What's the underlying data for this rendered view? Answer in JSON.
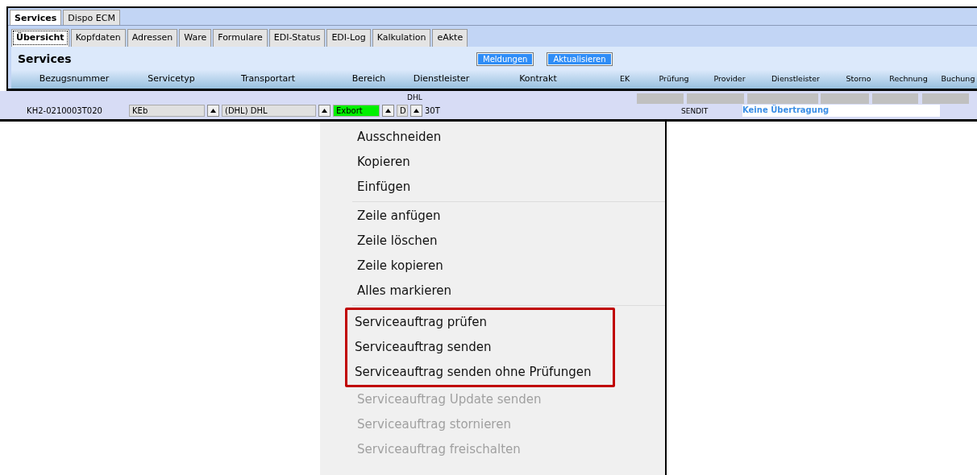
{
  "outer_tabs": [
    {
      "label": "Services",
      "selected": true
    },
    {
      "label": "Dispo ECM",
      "selected": false
    }
  ],
  "inner_tabs": [
    {
      "label": "Übersicht",
      "selected": true
    },
    {
      "label": "Kopfdaten",
      "selected": false
    },
    {
      "label": "Adressen",
      "selected": false
    },
    {
      "label": "Ware",
      "selected": false
    },
    {
      "label": "Formulare",
      "selected": false
    },
    {
      "label": "EDI-Status",
      "selected": false
    },
    {
      "label": "EDI-Log",
      "selected": false
    },
    {
      "label": "Kalkulation",
      "selected": false
    },
    {
      "label": "eAkte",
      "selected": false
    }
  ],
  "panel": {
    "title": "Services",
    "buttons": [
      "Meldungen",
      "Aktualisieren"
    ]
  },
  "columns": [
    "Bezugsnummer",
    "Servicetyp",
    "Transportart",
    "Bereich",
    "Dienstleister",
    "Kontrakt",
    "EK",
    "Prüfung",
    "Provider",
    "Dienstleister",
    "Storno",
    "Rechnung",
    "Buchung"
  ],
  "row": {
    "reference": "KH2-0210003T020",
    "servicetyp": "KEb",
    "transportart": "(DHL) DHL",
    "bereich": "Exbort",
    "dienstleister_label": "DHL",
    "dienstleister": "D",
    "kontrakt": "30T",
    "provider": "SENDIT",
    "status": "Keine Übertragung"
  },
  "context_menu": {
    "sections": [
      {
        "items": [
          {
            "label": "Ausschneiden",
            "disabled": false,
            "highlighted": false
          },
          {
            "label": "Kopieren",
            "disabled": false,
            "highlighted": false
          },
          {
            "label": "Einfügen",
            "disabled": false,
            "highlighted": false
          }
        ]
      },
      {
        "items": [
          {
            "label": "Zeile anfügen",
            "disabled": false,
            "highlighted": false
          },
          {
            "label": "Zeile löschen",
            "disabled": false,
            "highlighted": false
          },
          {
            "label": "Zeile kopieren",
            "disabled": false,
            "highlighted": false
          },
          {
            "label": "Alles markieren",
            "disabled": false,
            "highlighted": false
          }
        ]
      },
      {
        "items": [
          {
            "label": "Serviceauftrag prüfen",
            "disabled": false,
            "highlighted": true
          },
          {
            "label": "Serviceauftrag senden",
            "disabled": false,
            "highlighted": true
          },
          {
            "label": "Serviceauftrag senden ohne Prüfungen",
            "disabled": false,
            "highlighted": true
          },
          {
            "label": "Serviceauftrag Update senden",
            "disabled": true,
            "highlighted": false
          },
          {
            "label": "Serviceauftrag stornieren",
            "disabled": true,
            "highlighted": false
          },
          {
            "label": "Serviceauftrag freischalten",
            "disabled": true,
            "highlighted": false
          }
        ]
      }
    ]
  }
}
